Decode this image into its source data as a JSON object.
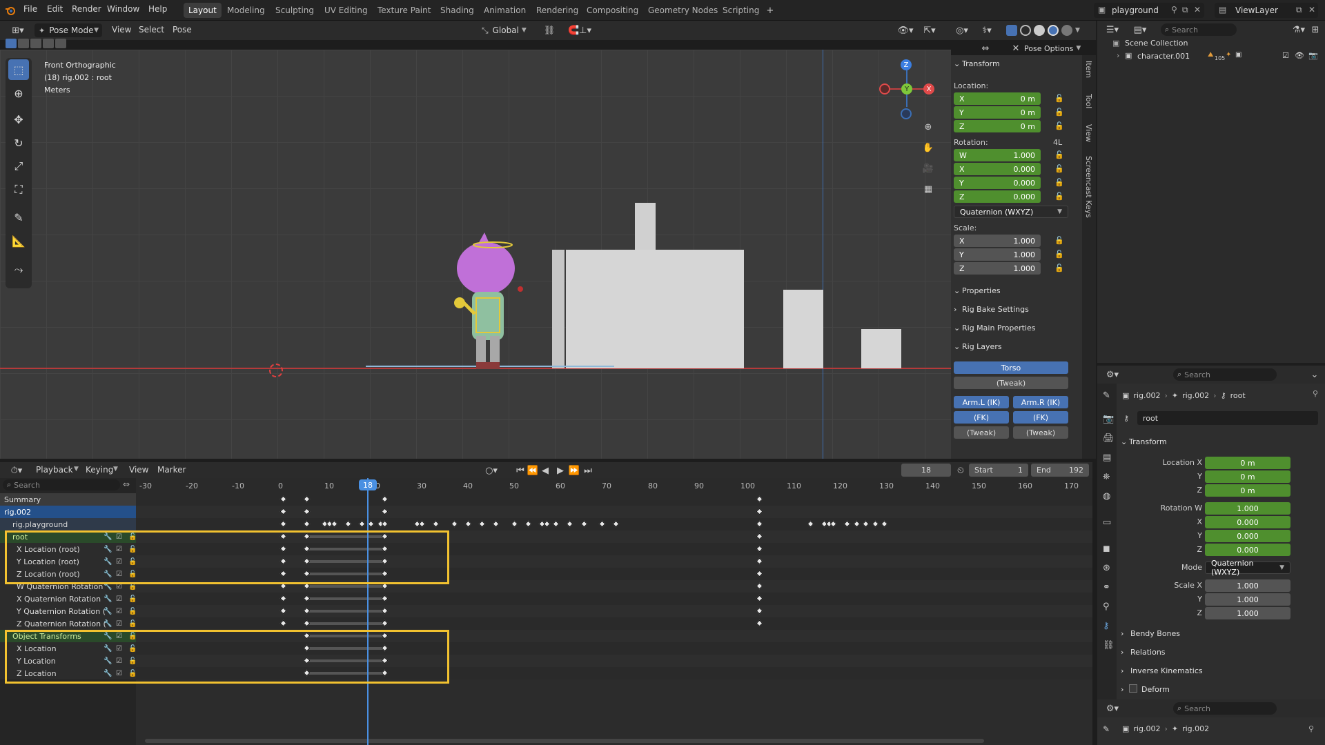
{
  "topbar": {
    "menus": [
      "File",
      "Edit",
      "Render",
      "Window",
      "Help"
    ],
    "workspaces": [
      "Layout",
      "Modeling",
      "Sculpting",
      "UV Editing",
      "Texture Paint",
      "Shading",
      "Animation",
      "Rendering",
      "Compositing",
      "Geometry Nodes",
      "Scripting"
    ],
    "scene_name": "playground",
    "view_layer": "ViewLayer"
  },
  "viewport_header": {
    "mode": "Pose Mode",
    "menus": [
      "View",
      "Select",
      "Pose"
    ],
    "orientation": "Global",
    "pose_options": "Pose Options",
    "search_placeholder": "Search"
  },
  "viewport": {
    "view_name": "Front Orthographic",
    "object_info": "(18) rig.002 : root",
    "units": "Meters",
    "gizmo": {
      "z": "Z",
      "y": "Y",
      "x": "X"
    }
  },
  "npanel": {
    "tabs": [
      "Item",
      "Tool",
      "View",
      "Screencast Keys"
    ],
    "transform_header": "Transform",
    "location_label": "Location:",
    "location": [
      {
        "axis": "X",
        "value": "0 m"
      },
      {
        "axis": "Y",
        "value": "0 m"
      },
      {
        "axis": "Z",
        "value": "0 m"
      }
    ],
    "rotation_label": "Rotation:",
    "rotation_mode_short": "4L",
    "rotation": [
      {
        "axis": "W",
        "value": "1.000"
      },
      {
        "axis": "X",
        "value": "0.000"
      },
      {
        "axis": "Y",
        "value": "0.000"
      },
      {
        "axis": "Z",
        "value": "0.000"
      }
    ],
    "rotation_mode": "Quaternion (WXYZ)",
    "scale_label": "Scale:",
    "scale": [
      {
        "axis": "X",
        "value": "1.000"
      },
      {
        "axis": "Y",
        "value": "1.000"
      },
      {
        "axis": "Z",
        "value": "1.000"
      }
    ],
    "properties": "Properties",
    "rig_bake": "Rig Bake Settings",
    "rig_main": "Rig Main Properties",
    "rig_layers": "Rig Layers",
    "layers": {
      "torso": "Torso",
      "tweak": "(Tweak)",
      "arm_l_ik": "Arm.L (IK)",
      "arm_r_ik": "Arm.R (IK)",
      "fk_l": "(FK)",
      "fk_r": "(FK)",
      "tweak_l": "(Tweak)",
      "tweak_r": "(Tweak)"
    }
  },
  "outliner": {
    "search_placeholder": "Search",
    "scene_collection": "Scene Collection",
    "item": "character.001",
    "item_badge": "105"
  },
  "properties": {
    "search_placeholder": "Search",
    "breadcrumb": [
      "rig.002",
      "rig.002",
      "root"
    ],
    "bone_name": "root",
    "transform_header": "Transform",
    "location": [
      {
        "label": "Location X",
        "value": "0 m"
      },
      {
        "label": "Y",
        "value": "0 m"
      },
      {
        "label": "Z",
        "value": "0 m"
      }
    ],
    "rotation": [
      {
        "label": "Rotation W",
        "value": "1.000"
      },
      {
        "label": "X",
        "value": "0.000"
      },
      {
        "label": "Y",
        "value": "0.000"
      },
      {
        "label": "Z",
        "value": "0.000"
      }
    ],
    "mode_label": "Mode",
    "mode_value": "Quaternion (WXYZ)",
    "scale": [
      {
        "label": "Scale X",
        "value": "1.000"
      },
      {
        "label": "Y",
        "value": "1.000"
      },
      {
        "label": "Z",
        "value": "1.000"
      }
    ],
    "sections": [
      "Bendy Bones",
      "Relations",
      "Inverse Kinematics",
      "Deform"
    ],
    "bottom_search": "Search",
    "bottom_breadcrumb": [
      "rig.002",
      "rig.002"
    ]
  },
  "timeline": {
    "menus": [
      "Playback",
      "Keying",
      "View",
      "Marker"
    ],
    "current_frame": "18",
    "start_label": "Start",
    "start": "1",
    "end_label": "End",
    "end": "192",
    "search_placeholder": "Search",
    "ticks": [
      "-30",
      "-20",
      "-10",
      "0",
      "10",
      "18",
      "20",
      "30",
      "40",
      "50",
      "60",
      "70",
      "80",
      "90",
      "100",
      "110",
      "120",
      "130",
      "140",
      "150",
      "160",
      "170"
    ],
    "channels": [
      {
        "label": "Summary"
      },
      {
        "label": "rig.002"
      },
      {
        "label": "rig.playground"
      },
      {
        "label": "root"
      },
      {
        "label": "X Location (root)"
      },
      {
        "label": "Y Location (root)"
      },
      {
        "label": "Z Location (root)"
      },
      {
        "label": "W Quaternion Rotation"
      },
      {
        "label": "X Quaternion Rotation"
      },
      {
        "label": "Y Quaternion Rotation ("
      },
      {
        "label": "Z Quaternion Rotation ("
      },
      {
        "label": "Object Transforms"
      },
      {
        "label": "X Location"
      },
      {
        "label": "Y Location"
      },
      {
        "label": "Z Location"
      }
    ]
  },
  "colors": {
    "accent": "#4772b3",
    "green_field": "#4f8f2e",
    "highlight_box": "#f2c230",
    "playhead": "#4a90e2"
  }
}
